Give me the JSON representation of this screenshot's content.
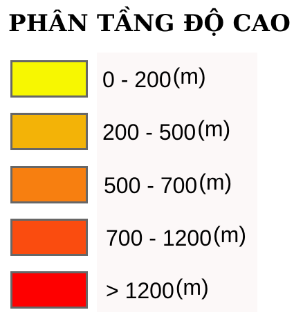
{
  "legend": {
    "title": "PHÂN TẦNG ĐỘ CAO",
    "items": [
      {
        "range": "0 - 200",
        "unit": "(m)",
        "color": "#f7f701"
      },
      {
        "range": "200 - 500",
        "unit": "(m)",
        "color": "#f3b307"
      },
      {
        "range": "500 - 700",
        "unit": "(m)",
        "color": "#f77f10"
      },
      {
        "range": "700 - 1200",
        "unit": "(m)",
        "color": "#fa4c0f"
      },
      {
        "range": "> 1200",
        "unit": "(m)",
        "color": "#fe0000"
      }
    ]
  }
}
